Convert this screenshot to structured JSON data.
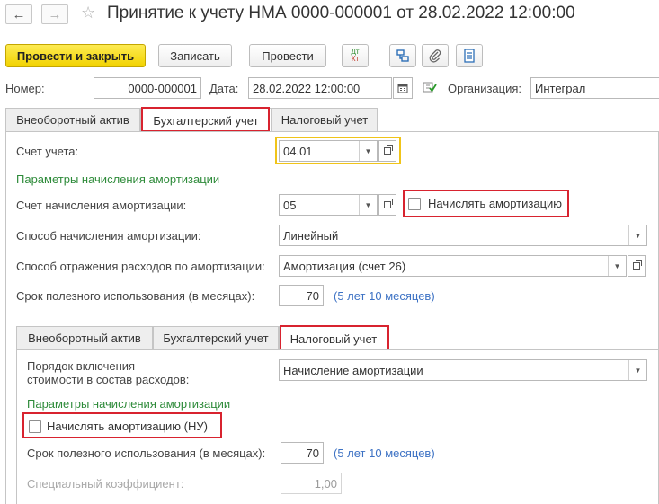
{
  "header": {
    "back_icon": "arrow-left-icon",
    "forward_icon": "arrow-right-icon",
    "star_icon": "star-icon",
    "title": "Принятие к учету НМА 0000-000001 от 28.02.2022 12:00:00"
  },
  "toolbar": {
    "post_close_label": "Провести и закрыть",
    "save_label": "Записать",
    "post_label": "Провести",
    "dt_kt_top": "Дт",
    "dt_kt_bottom": "Кт"
  },
  "doc": {
    "number_label": "Номер:",
    "number_value": "0000-000001",
    "date_label": "Дата:",
    "date_value": "28.02.2022 12:00:00",
    "org_label": "Организация:",
    "org_value": "Интеграл"
  },
  "tabs_top": [
    "Внеоборотный актив",
    "Бухгалтерский учет",
    "Налоговый учет"
  ],
  "accounting": {
    "account_label": "Счет учета:",
    "account_value": "04.01",
    "group_title": "Параметры начисления амортизации",
    "amort_account_label": "Счет начисления амортизации:",
    "amort_account_value": "05",
    "accrue_checkbox_label": "Начислять амортизацию",
    "method_label": "Способ начисления амортизации:",
    "method_value": "Линейный",
    "expense_label": "Способ отражения расходов по амортизации:",
    "expense_value": "Амортизация (счет 26)",
    "life_label": "Срок полезного использования (в месяцах):",
    "life_value": "70",
    "life_hint": "(5 лет 10 месяцев)"
  },
  "tabs_bottom": [
    "Внеоборотный актив",
    "Бухгалтерский учет",
    "Налоговый учет"
  ],
  "tax": {
    "order_label_1": "Порядок включения",
    "order_label_2": "стоимости в состав расходов:",
    "order_value": "Начисление амортизации",
    "group_title": "Параметры начисления амортизации",
    "accrue_checkbox_label": "Начислять амортизацию (НУ)",
    "life_label": "Срок полезного использования (в месяцах):",
    "life_value": "70",
    "life_hint": "(5 лет 10 месяцев)",
    "coef_label": "Специальный коэффициент:",
    "coef_value": "1,00"
  },
  "colors": {
    "primary_button": "#f2d300",
    "group_title": "#2e8b3a",
    "hint": "#3d72c4",
    "highlight": "#d8232f",
    "focus_border": "#f0c419"
  }
}
